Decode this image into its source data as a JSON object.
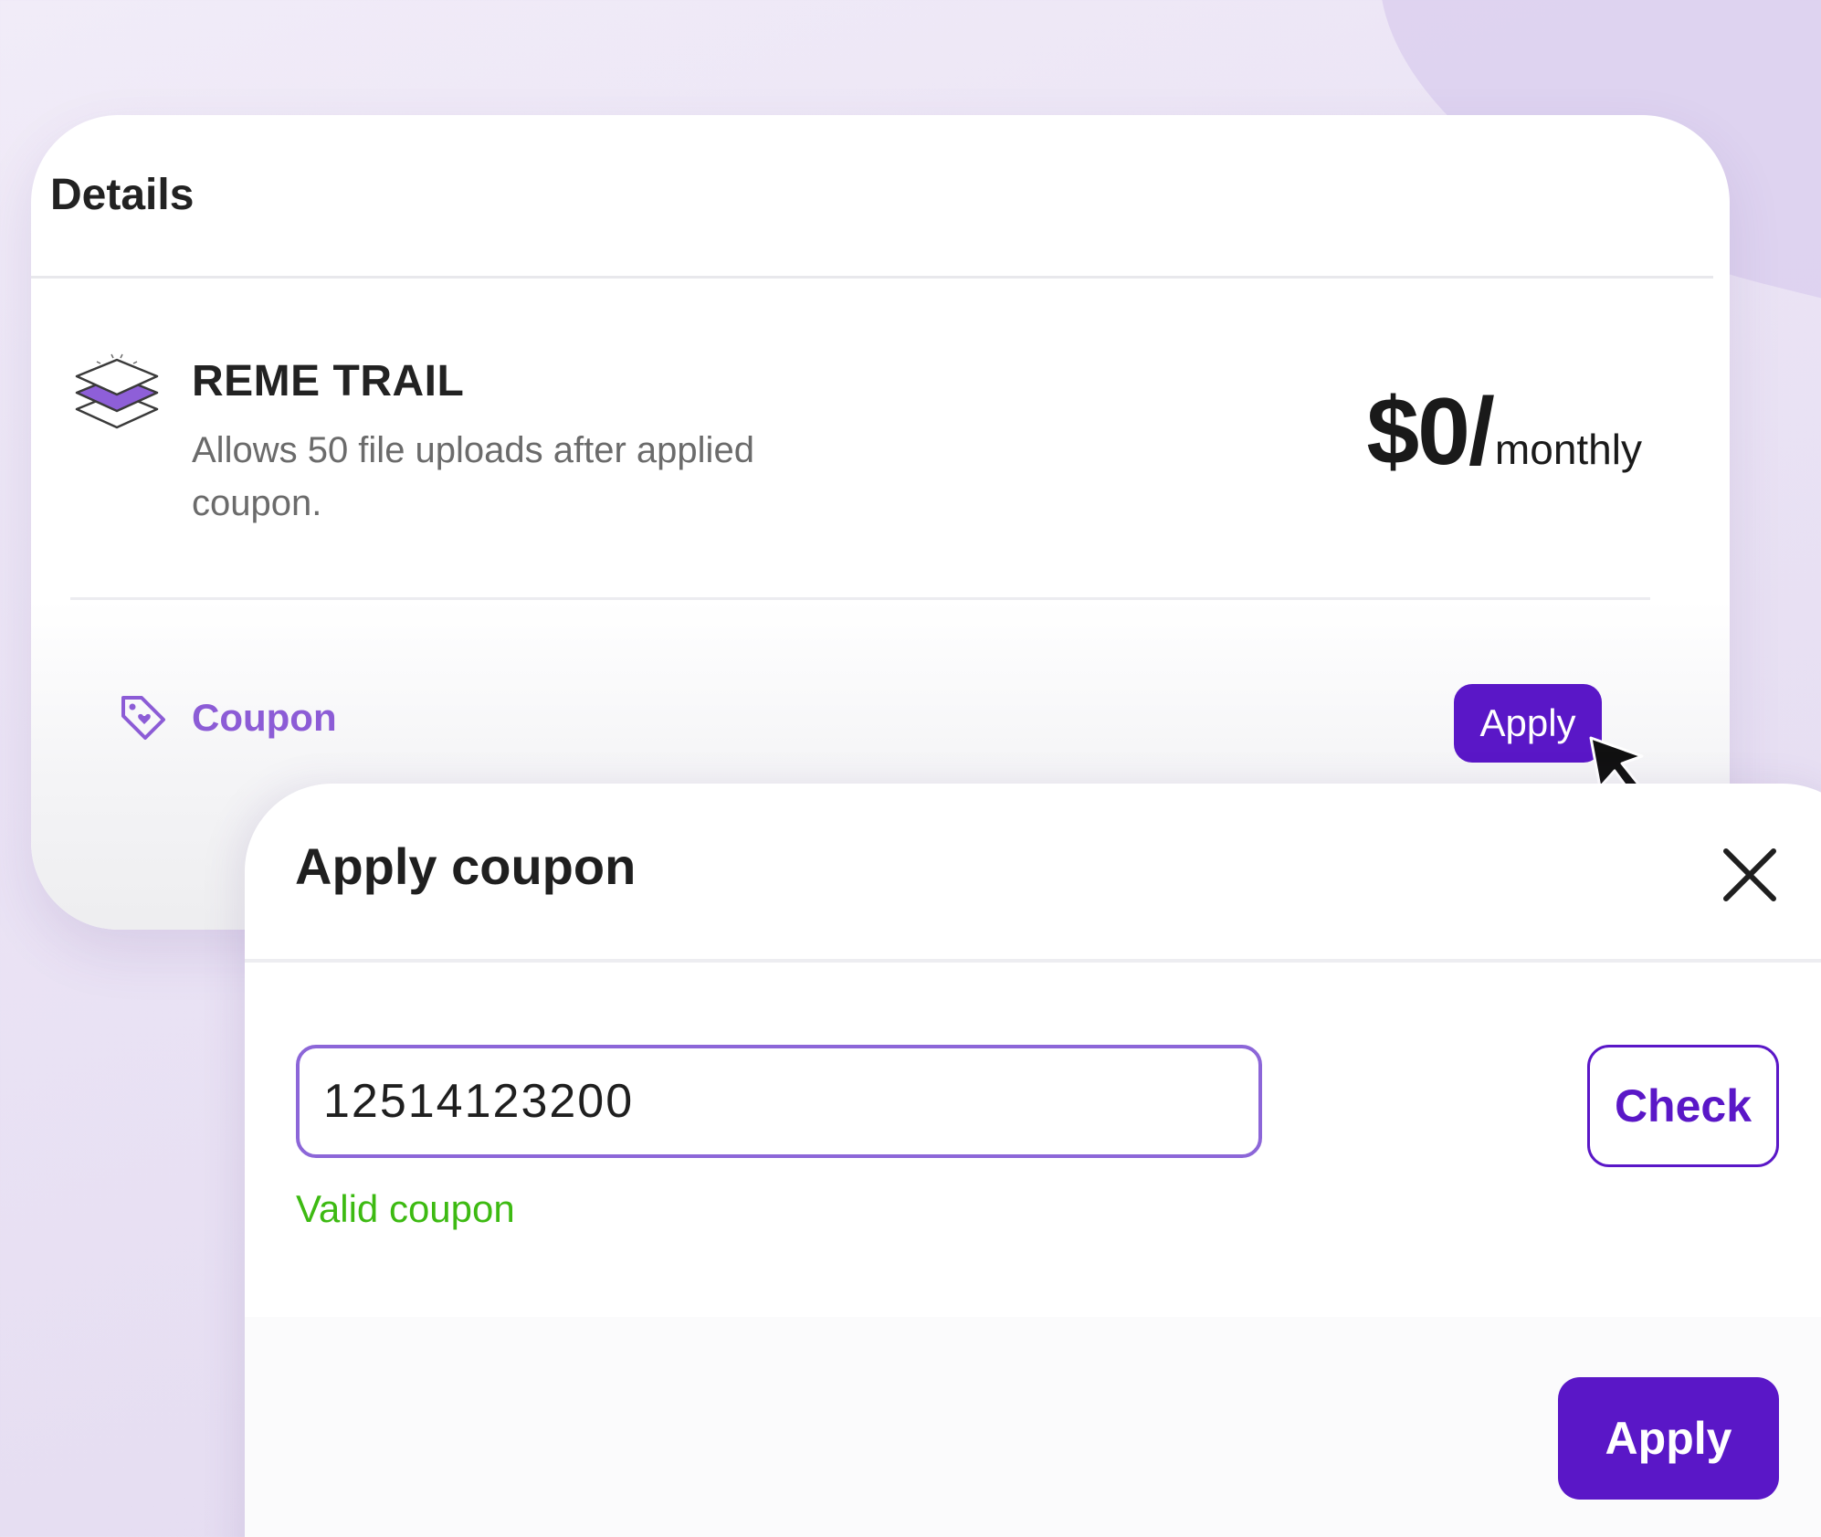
{
  "details": {
    "title": "Details",
    "plan": {
      "icon": "layers-icon",
      "name": "REME TRAIL",
      "description": "Allows 50 file uploads after applied coupon.",
      "price_amount": "$0/",
      "price_period": "monthly"
    },
    "coupon": {
      "icon": "tag-icon",
      "label": "Coupon",
      "apply_label": "Apply"
    }
  },
  "modal": {
    "title": "Apply coupon",
    "close_icon": "close-icon",
    "input_value": "12514123200",
    "check_label": "Check",
    "status_message": "Valid coupon",
    "apply_label": "Apply"
  },
  "colors": {
    "accent": "#5a17c7",
    "accent_light": "#8c5cd6",
    "input_border": "#8c66d8",
    "success": "#3dba12",
    "background": "#ebe4f5"
  }
}
